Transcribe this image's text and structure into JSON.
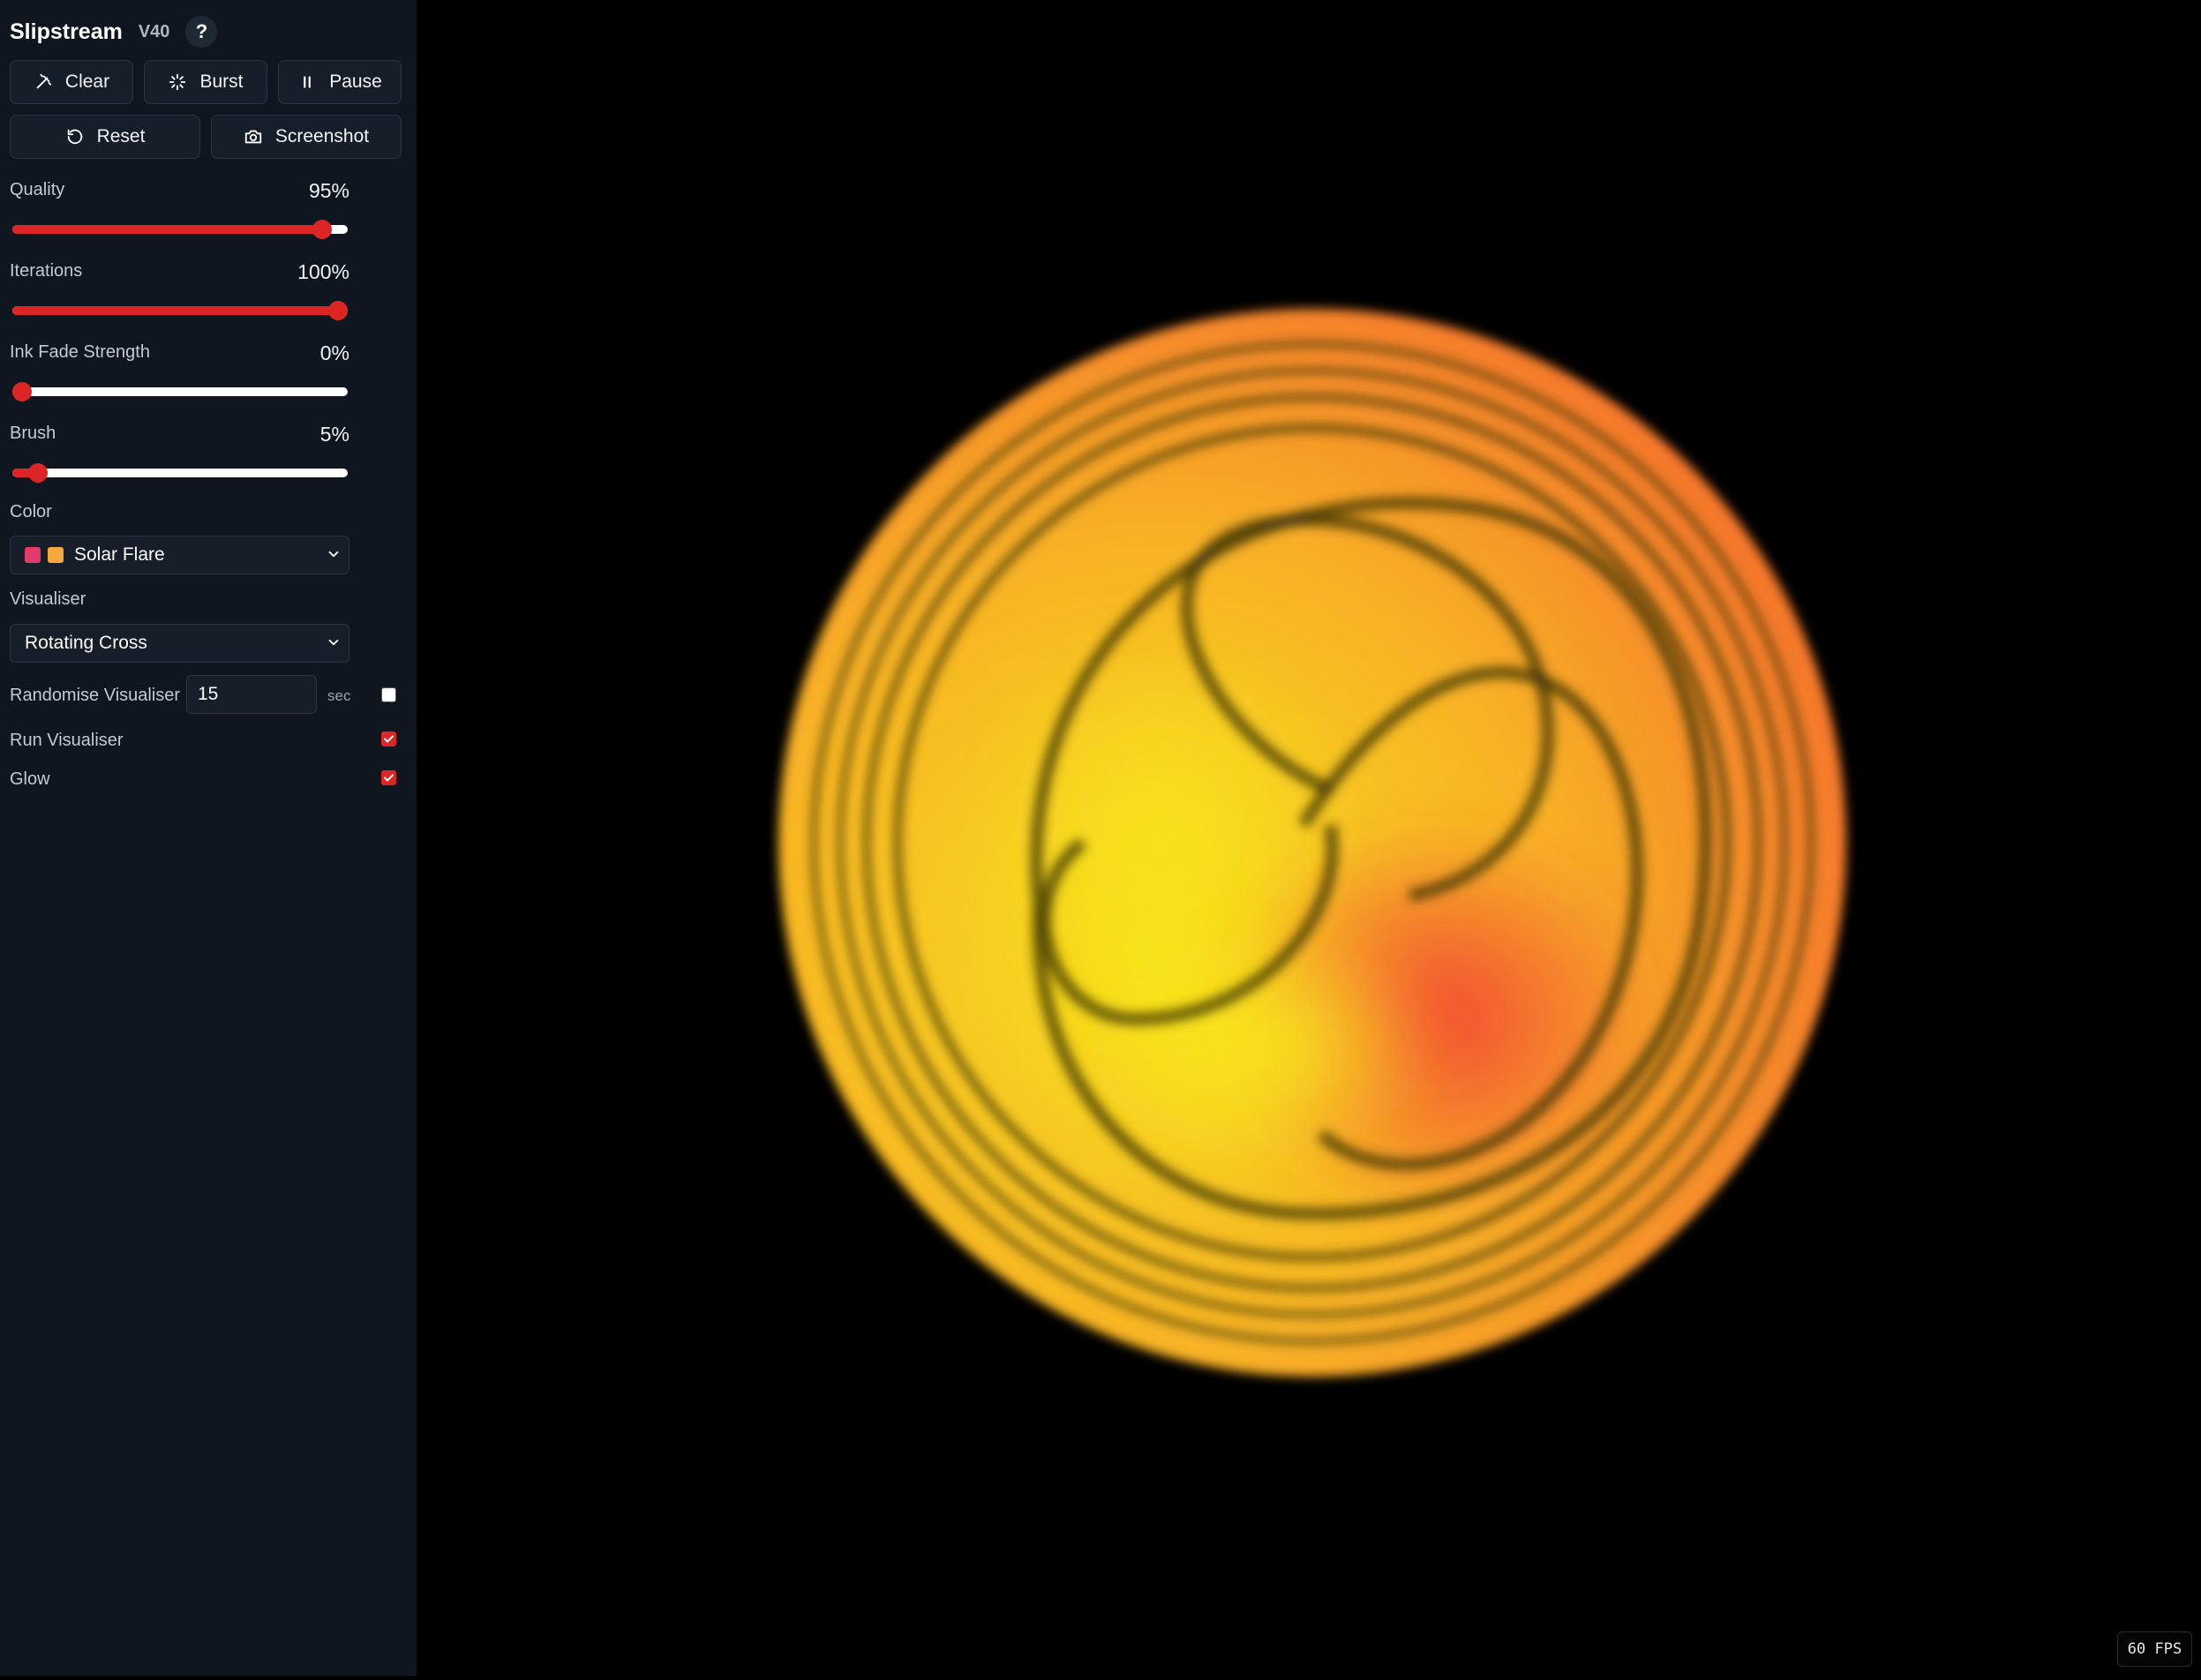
{
  "header": {
    "title": "Slipstream",
    "version": "V40",
    "help_label": "?"
  },
  "toolbar": {
    "clear_label": "Clear",
    "burst_label": "Burst",
    "pause_label": "Pause",
    "reset_label": "Reset",
    "screenshot_label": "Screenshot"
  },
  "sliders": {
    "quality": {
      "label": "Quality",
      "value_text": "95%",
      "fraction": 0.95
    },
    "iterations": {
      "label": "Iterations",
      "value_text": "100%",
      "fraction": 1.0
    },
    "ink_fade": {
      "label": "Ink Fade Strength",
      "value_text": "0%",
      "fraction": 0.0
    },
    "brush": {
      "label": "Brush",
      "value_text": "5%",
      "fraction": 0.05
    }
  },
  "color": {
    "label": "Color",
    "selected": "Solar Flare",
    "swatches": [
      "#e23a6a",
      "#f6a93b"
    ]
  },
  "visualiser": {
    "label": "Visualiser",
    "selected": "Rotating Cross"
  },
  "randomise": {
    "label": "Randomise Visualiser",
    "value": "15",
    "unit": "sec",
    "checked": false
  },
  "run_visualiser": {
    "label": "Run Visualiser",
    "checked": true
  },
  "glow": {
    "label": "Glow",
    "checked": true
  },
  "status": {
    "fps": "60 FPS"
  },
  "accent_color": "#dc2626"
}
